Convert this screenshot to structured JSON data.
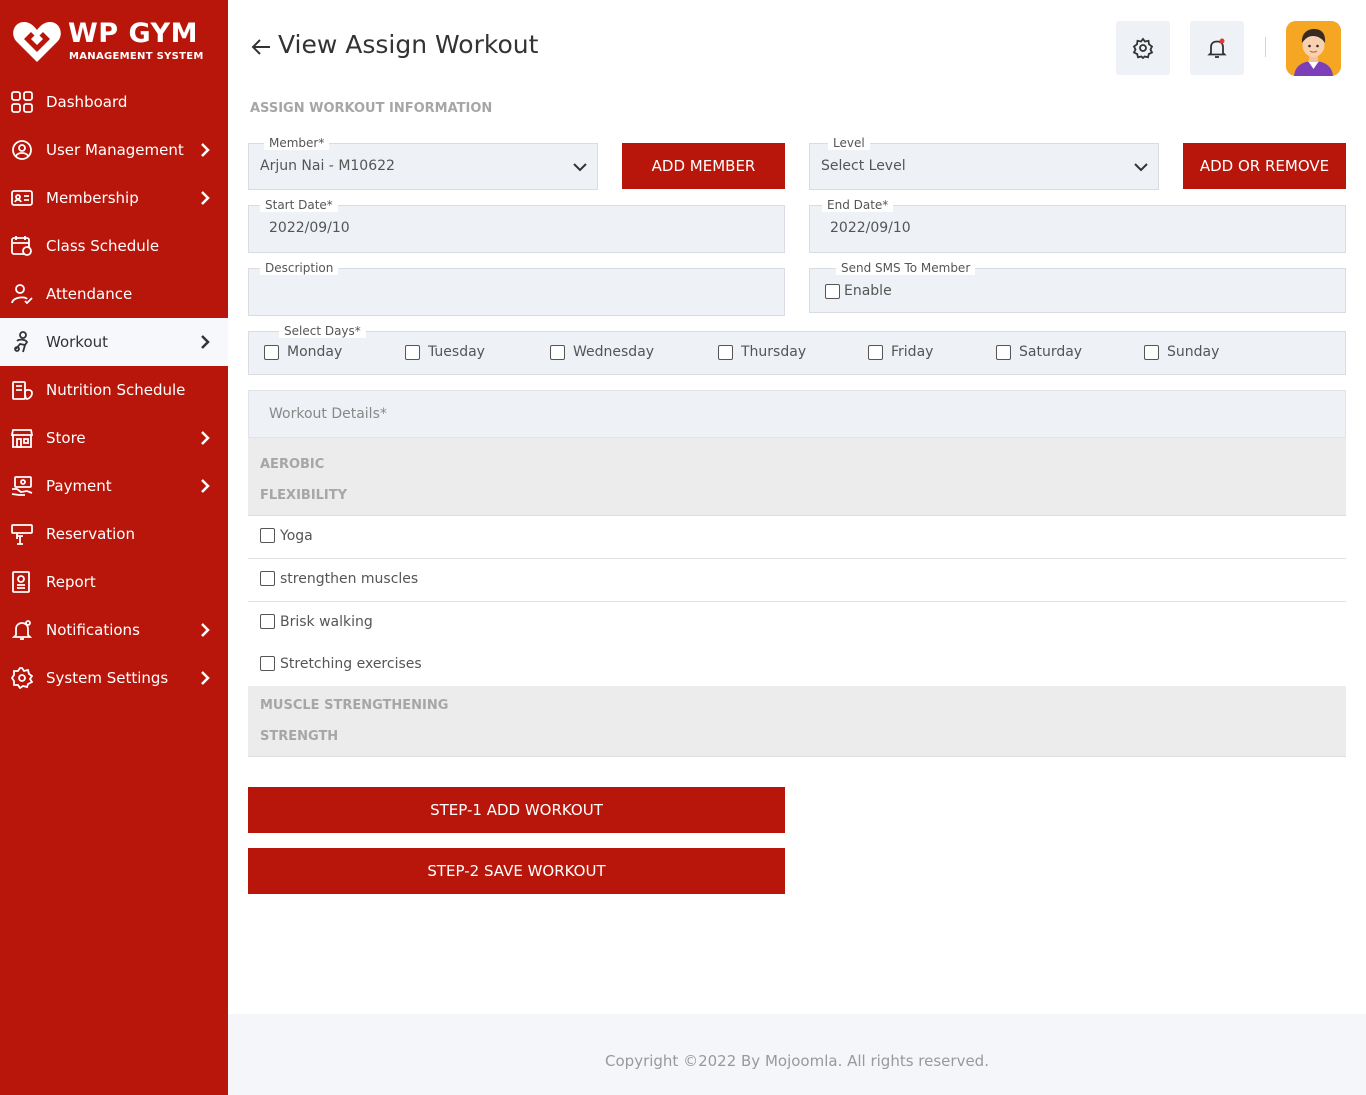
{
  "brand": {
    "title": "WP GYM",
    "subtitle": "MANAGEMENT SYSTEM"
  },
  "sidebar": {
    "items": [
      {
        "label": "Dashboard",
        "icon": "dashboard-icon",
        "has_chevron": false,
        "active": false
      },
      {
        "label": "User Management",
        "icon": "user-management-icon",
        "has_chevron": true,
        "active": false
      },
      {
        "label": "Membership",
        "icon": "membership-card-icon",
        "has_chevron": true,
        "active": false
      },
      {
        "label": "Class Schedule",
        "icon": "calendar-icon",
        "has_chevron": false,
        "active": false
      },
      {
        "label": "Attendance",
        "icon": "attendance-icon",
        "has_chevron": false,
        "active": false
      },
      {
        "label": "Workout",
        "icon": "workout-icon",
        "has_chevron": true,
        "active": true
      },
      {
        "label": "Nutrition Schedule",
        "icon": "nutrition-icon",
        "has_chevron": false,
        "active": false
      },
      {
        "label": "Store",
        "icon": "store-icon",
        "has_chevron": true,
        "active": false
      },
      {
        "label": "Payment",
        "icon": "payment-icon",
        "has_chevron": true,
        "active": false
      },
      {
        "label": "Reservation",
        "icon": "reservation-icon",
        "has_chevron": false,
        "active": false
      },
      {
        "label": "Report",
        "icon": "report-icon",
        "has_chevron": false,
        "active": false
      },
      {
        "label": "Notifications",
        "icon": "notification-bell-icon",
        "has_chevron": true,
        "active": false
      },
      {
        "label": "System Settings",
        "icon": "gear-icon",
        "has_chevron": true,
        "active": false
      }
    ]
  },
  "header": {
    "title": "View Assign Workout"
  },
  "form": {
    "section_title": "ASSIGN WORKOUT INFORMATION",
    "member_label": "Member*",
    "member_value": "Arjun Nai - M10622",
    "add_member_label": "ADD MEMBER",
    "level_label": "Level",
    "level_value": "Select Level",
    "add_remove_label": "ADD OR REMOVE",
    "start_date_label": "Start Date*",
    "start_date_value": "2022/09/10",
    "end_date_label": "End Date*",
    "end_date_value": "2022/09/10",
    "description_label": "Description",
    "description_value": "",
    "sms_label": "Send SMS To Member",
    "sms_option": "Enable",
    "days_label": "Select Days*",
    "days": [
      "Monday",
      "Tuesday",
      "Wednesday",
      "Thursday",
      "Friday",
      "Saturday",
      "Sunday"
    ]
  },
  "workout": {
    "details_placeholder": "Workout Details*",
    "category_1": "AEROBIC",
    "subcategory_1": "FLEXIBILITY",
    "activities": [
      "Yoga",
      "strengthen muscles",
      "Brisk walking",
      "Stretching exercises"
    ],
    "category_2": "MUSCLE STRENGTHENING",
    "subcategory_2": "STRENGTH"
  },
  "actions": {
    "step1_label": "STEP-1 ADD WORKOUT",
    "step2_label": "STEP-2 SAVE WORKOUT"
  },
  "footer": {
    "copyright": "Copyright ©2022 By Mojoomla. All rights reserved."
  },
  "colors": {
    "brand_red": "#b9160b",
    "field_bg": "#eef1f6",
    "avatar_bg": "#f5a623",
    "notification_dot": "#e53935"
  }
}
